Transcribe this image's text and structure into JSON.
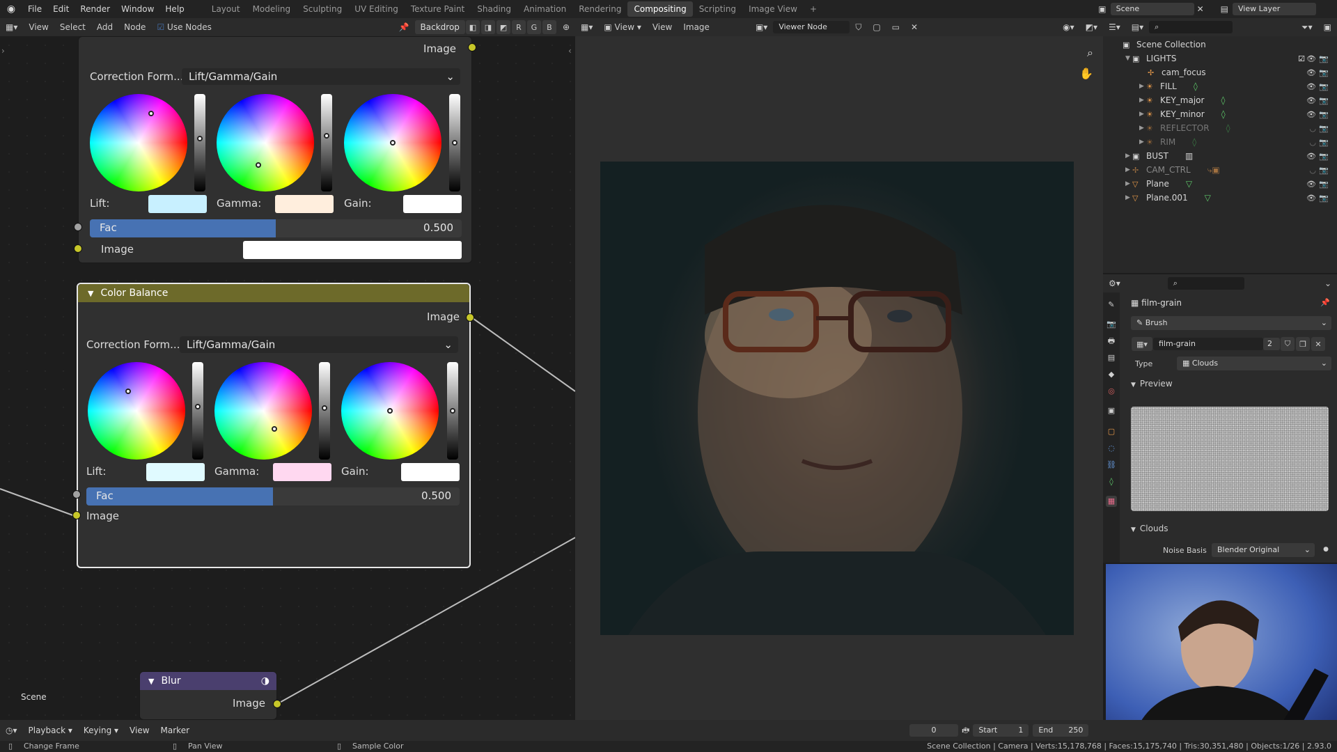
{
  "topbar": {
    "menus": [
      "File",
      "Edit",
      "Render",
      "Window",
      "Help"
    ],
    "workspaces": [
      "Layout",
      "Modeling",
      "Sculpting",
      "UV Editing",
      "Texture Paint",
      "Shading",
      "Animation",
      "Rendering",
      "Compositing",
      "Scripting",
      "Image View"
    ],
    "active_workspace": "Compositing",
    "scene": "Scene",
    "view_layer": "View Layer"
  },
  "node_header": {
    "view": "View",
    "select": "Select",
    "add": "Add",
    "node": "Node",
    "use_nodes": "Use Nodes",
    "backdrop": "Backdrop",
    "channels": [
      "R",
      "G",
      "B"
    ]
  },
  "node1": {
    "output_label": "Image",
    "correction_label": "Correction Form...",
    "correction_value": "Lift/Gamma/Gain",
    "lift_label": "Lift:",
    "gamma_label": "Gamma:",
    "gain_label": "Gain:",
    "fac_label": "Fac",
    "fac_value": "0.500",
    "fac_fraction": 0.5,
    "image_label": "Image",
    "lift_color": "#c8f0ff",
    "gamma_color": "#ffeedd",
    "gain_color": "#ffffff"
  },
  "node2": {
    "title": "Color Balance",
    "output_label": "Image",
    "correction_label": "Correction Form...",
    "correction_value": "Lift/Gamma/Gain",
    "lift_label": "Lift:",
    "gamma_label": "Gamma:",
    "gain_label": "Gain:",
    "fac_label": "Fac",
    "fac_value": "0.500",
    "fac_fraction": 0.5,
    "image_label": "Image",
    "lift_color": "#e0faff",
    "gamma_color": "#ffd8f0",
    "gain_color": "#ffffff",
    "header_color": "#6d6a2a"
  },
  "blur_node": {
    "title": "Blur",
    "output_label": "Image",
    "header_color": "#4a3f6e"
  },
  "scene_label": "Scene",
  "viewer_header": {
    "view1": "View",
    "view2": "View",
    "image": "Image",
    "viewer_node": "Viewer Node"
  },
  "outliner": {
    "title": "Scene Collection",
    "items": [
      {
        "label": "LIGHTS",
        "level": 1
      },
      {
        "label": "cam_focus",
        "level": 2
      },
      {
        "label": "FILL",
        "level": 2
      },
      {
        "label": "KEY_major",
        "level": 2
      },
      {
        "label": "KEY_minor",
        "level": 2
      },
      {
        "label": "REFLECTOR",
        "level": 2
      },
      {
        "label": "RIM",
        "level": 2
      },
      {
        "label": "BUST",
        "level": 1
      },
      {
        "label": "CAM_CTRL",
        "level": 1
      },
      {
        "label": "Plane",
        "level": 1
      },
      {
        "label": "Plane.001",
        "level": 1
      }
    ]
  },
  "properties": {
    "texture_name": "film-grain",
    "brush": "Brush",
    "texture_field": "film-grain",
    "users": "2",
    "type_label": "Type",
    "type_value": "Clouds",
    "preview_label": "Preview",
    "clouds_label": "Clouds",
    "noise_basis_label": "Noise Basis",
    "noise_basis_value": "Blender Original"
  },
  "timeline": {
    "playback": "Playback",
    "keying": "Keying",
    "view": "View",
    "marker": "Marker",
    "current_frame": "0",
    "start_label": "Start",
    "start_value": "1",
    "end_label": "End",
    "end_value": "250"
  },
  "status": {
    "left1": "Change Frame",
    "left2": "Pan View",
    "left3": "Sample Color",
    "stats": "Scene Collection | Camera | Verts:15,178,768 | Faces:15,175,740 | Tris:30,351,480 | Objects:1/26 | 2.93.0"
  }
}
